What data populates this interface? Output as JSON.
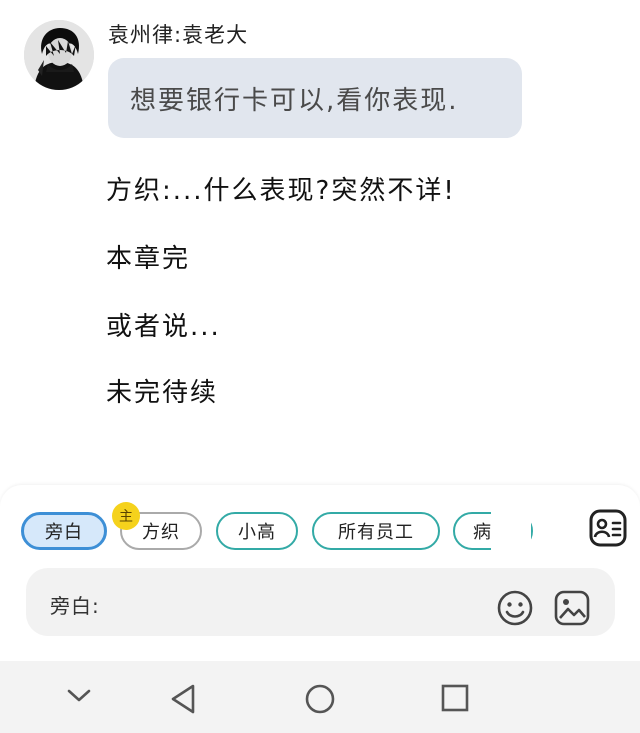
{
  "chat": {
    "sender_name": "袁州律:袁老大",
    "bubble_text": "想要银行卡可以,看你表现.",
    "narration": [
      "方织:...什么表现?突然不详!",
      "本章完",
      "或者说...",
      "未完待续"
    ]
  },
  "characters": {
    "badge": "主",
    "chips": [
      {
        "label": "旁白",
        "state": "selected"
      },
      {
        "label": "方织",
        "state": "normal"
      },
      {
        "label": "小高",
        "state": "normal"
      },
      {
        "label": "所有员工",
        "state": "normal"
      },
      {
        "label": "病",
        "state": "normal"
      }
    ]
  },
  "input": {
    "label": "旁白:"
  },
  "icons": {
    "contact": "contact-card-icon",
    "emoji": "emoji-icon",
    "image": "image-icon",
    "nav_down": "chevron-down-icon",
    "nav_back": "back-triangle-icon",
    "nav_home": "home-circle-icon",
    "nav_recent": "recent-square-icon"
  },
  "colors": {
    "bubble_bg": "#e1e6ee",
    "selected_chip_border": "#3d8fd6",
    "selected_chip_bg": "#d6e8fa",
    "teal_chip_border": "#33aaa6",
    "badge": "#f5d21c"
  }
}
